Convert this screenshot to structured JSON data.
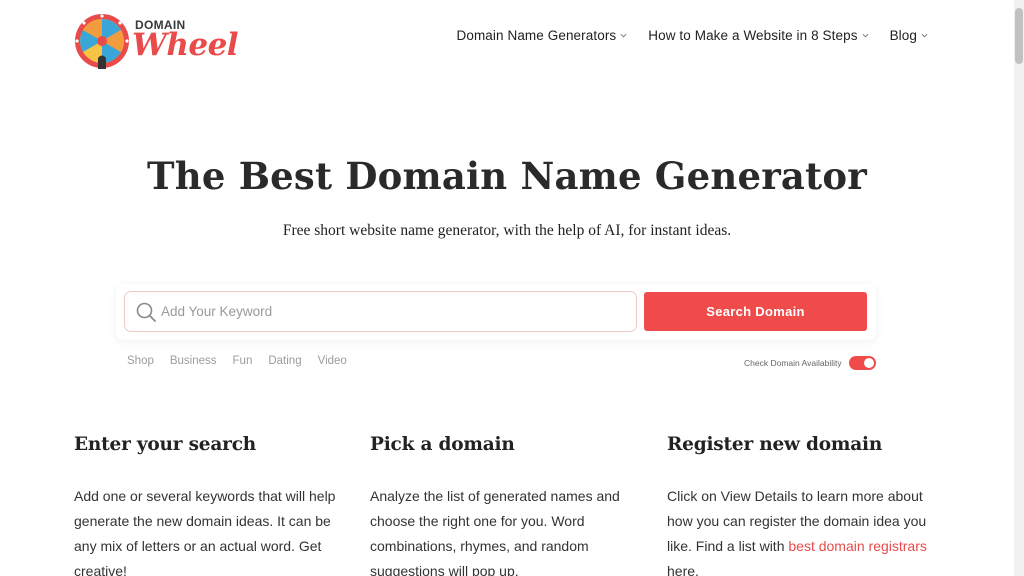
{
  "brand": {
    "small": "DOMAIN",
    "big": "Wheel"
  },
  "nav": [
    {
      "label": "Domain Name Generators"
    },
    {
      "label": "How to Make a Website in 8 Steps"
    },
    {
      "label": "Blog"
    }
  ],
  "hero": {
    "title": "The Best Domain Name Generator",
    "subtitle": "Free short website name generator, with the help of AI, for instant ideas."
  },
  "search": {
    "placeholder": "Add Your Keyword",
    "value": "",
    "button_label": "Search Domain"
  },
  "tags": [
    "Shop",
    "Business",
    "Fun",
    "Dating",
    "Video"
  ],
  "availability": {
    "label": "Check Domain Availability",
    "enabled": true
  },
  "steps": [
    {
      "title": "Enter your search",
      "text": "Add one or several keywords that will help generate the new domain ideas. It can be any mix of letters or an actual word. Get creative!"
    },
    {
      "title": "Pick a domain",
      "text": "Analyze the list of generated names and choose the right one for you. Word combinations, rhymes, and random suggestions will pop up."
    },
    {
      "title": "Register new domain",
      "text_before": "Click on View Details to learn more about how you can register the domain idea you like. Find a list with ",
      "link": "best domain registrars",
      "text_after": " here."
    }
  ],
  "colors": {
    "accent": "#ef4b4b",
    "text": "#222222",
    "muted": "#9c9c9c"
  },
  "icons": [
    "wheel-logo-icon",
    "chevron-down-icon",
    "search-icon"
  ]
}
